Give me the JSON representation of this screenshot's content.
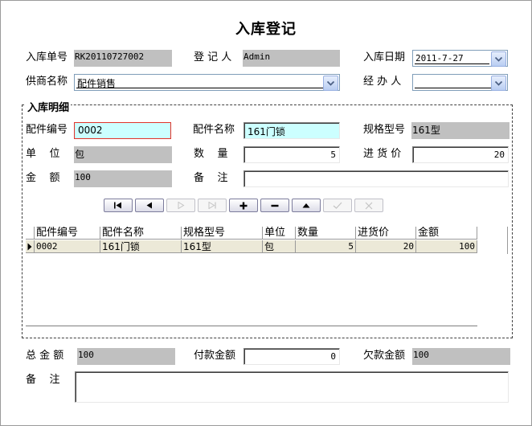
{
  "window": {
    "title": "入库登记"
  },
  "header": {
    "order_no_label": "入库单号",
    "order_no": "RK20110727002",
    "registrar_label": "登 记 人",
    "registrar": "Admin",
    "date_label": "入库日期",
    "date": "2011-7-27",
    "supplier_label": "供商名称",
    "supplier": "配件销售",
    "handler_label": "经 办 人",
    "handler": ""
  },
  "detail": {
    "legend": "入库明细",
    "part_no_label": "配件编号",
    "part_no": "0002",
    "part_name_label": "配件名称",
    "part_name": "161门锁",
    "spec_label": "规格型号",
    "spec": "161型",
    "unit_label": "单    位",
    "unit": "包",
    "qty_label": "数    量",
    "qty": "5",
    "price_label": "进 货 价",
    "price": "20",
    "amount_label": "金    额",
    "amount": "100",
    "remark_label": "备    注",
    "remark": ""
  },
  "navigator": {
    "buttons": [
      {
        "name": "first-record",
        "icon": "first-icon",
        "enabled": true
      },
      {
        "name": "prior-record",
        "icon": "prior-icon",
        "enabled": true
      },
      {
        "name": "next-record",
        "icon": "next-icon",
        "enabled": false
      },
      {
        "name": "last-record",
        "icon": "last-icon",
        "enabled": false
      },
      {
        "name": "insert-record",
        "icon": "plus-icon",
        "enabled": true
      },
      {
        "name": "delete-record",
        "icon": "minus-icon",
        "enabled": true
      },
      {
        "name": "edit-record",
        "icon": "up-triangle-icon",
        "enabled": true
      },
      {
        "name": "post-record",
        "icon": "check-icon",
        "enabled": false
      },
      {
        "name": "cancel-record",
        "icon": "x-icon",
        "enabled": false
      }
    ]
  },
  "grid": {
    "columns": [
      "配件编号",
      "配件名称",
      "规格型号",
      "单位",
      "数量",
      "进货价",
      "金额"
    ],
    "rows": [
      [
        "0002",
        "161门锁",
        "161型",
        "包",
        "5",
        "20",
        "100"
      ]
    ],
    "row_indicator_icon": "current-row-icon"
  },
  "footer": {
    "total_label": "总 金 额",
    "total": "100",
    "paid_label": "付款金额",
    "paid": "0",
    "owed_label": "欠款金额",
    "owed": "100",
    "remark_label": "备    注",
    "remark": ""
  },
  "colors": {
    "readonly_bg": "#c0c0c0",
    "highlight_bg": "#ccffff",
    "focus_border": "#e0342a",
    "row_bg": "#ece9d8"
  }
}
